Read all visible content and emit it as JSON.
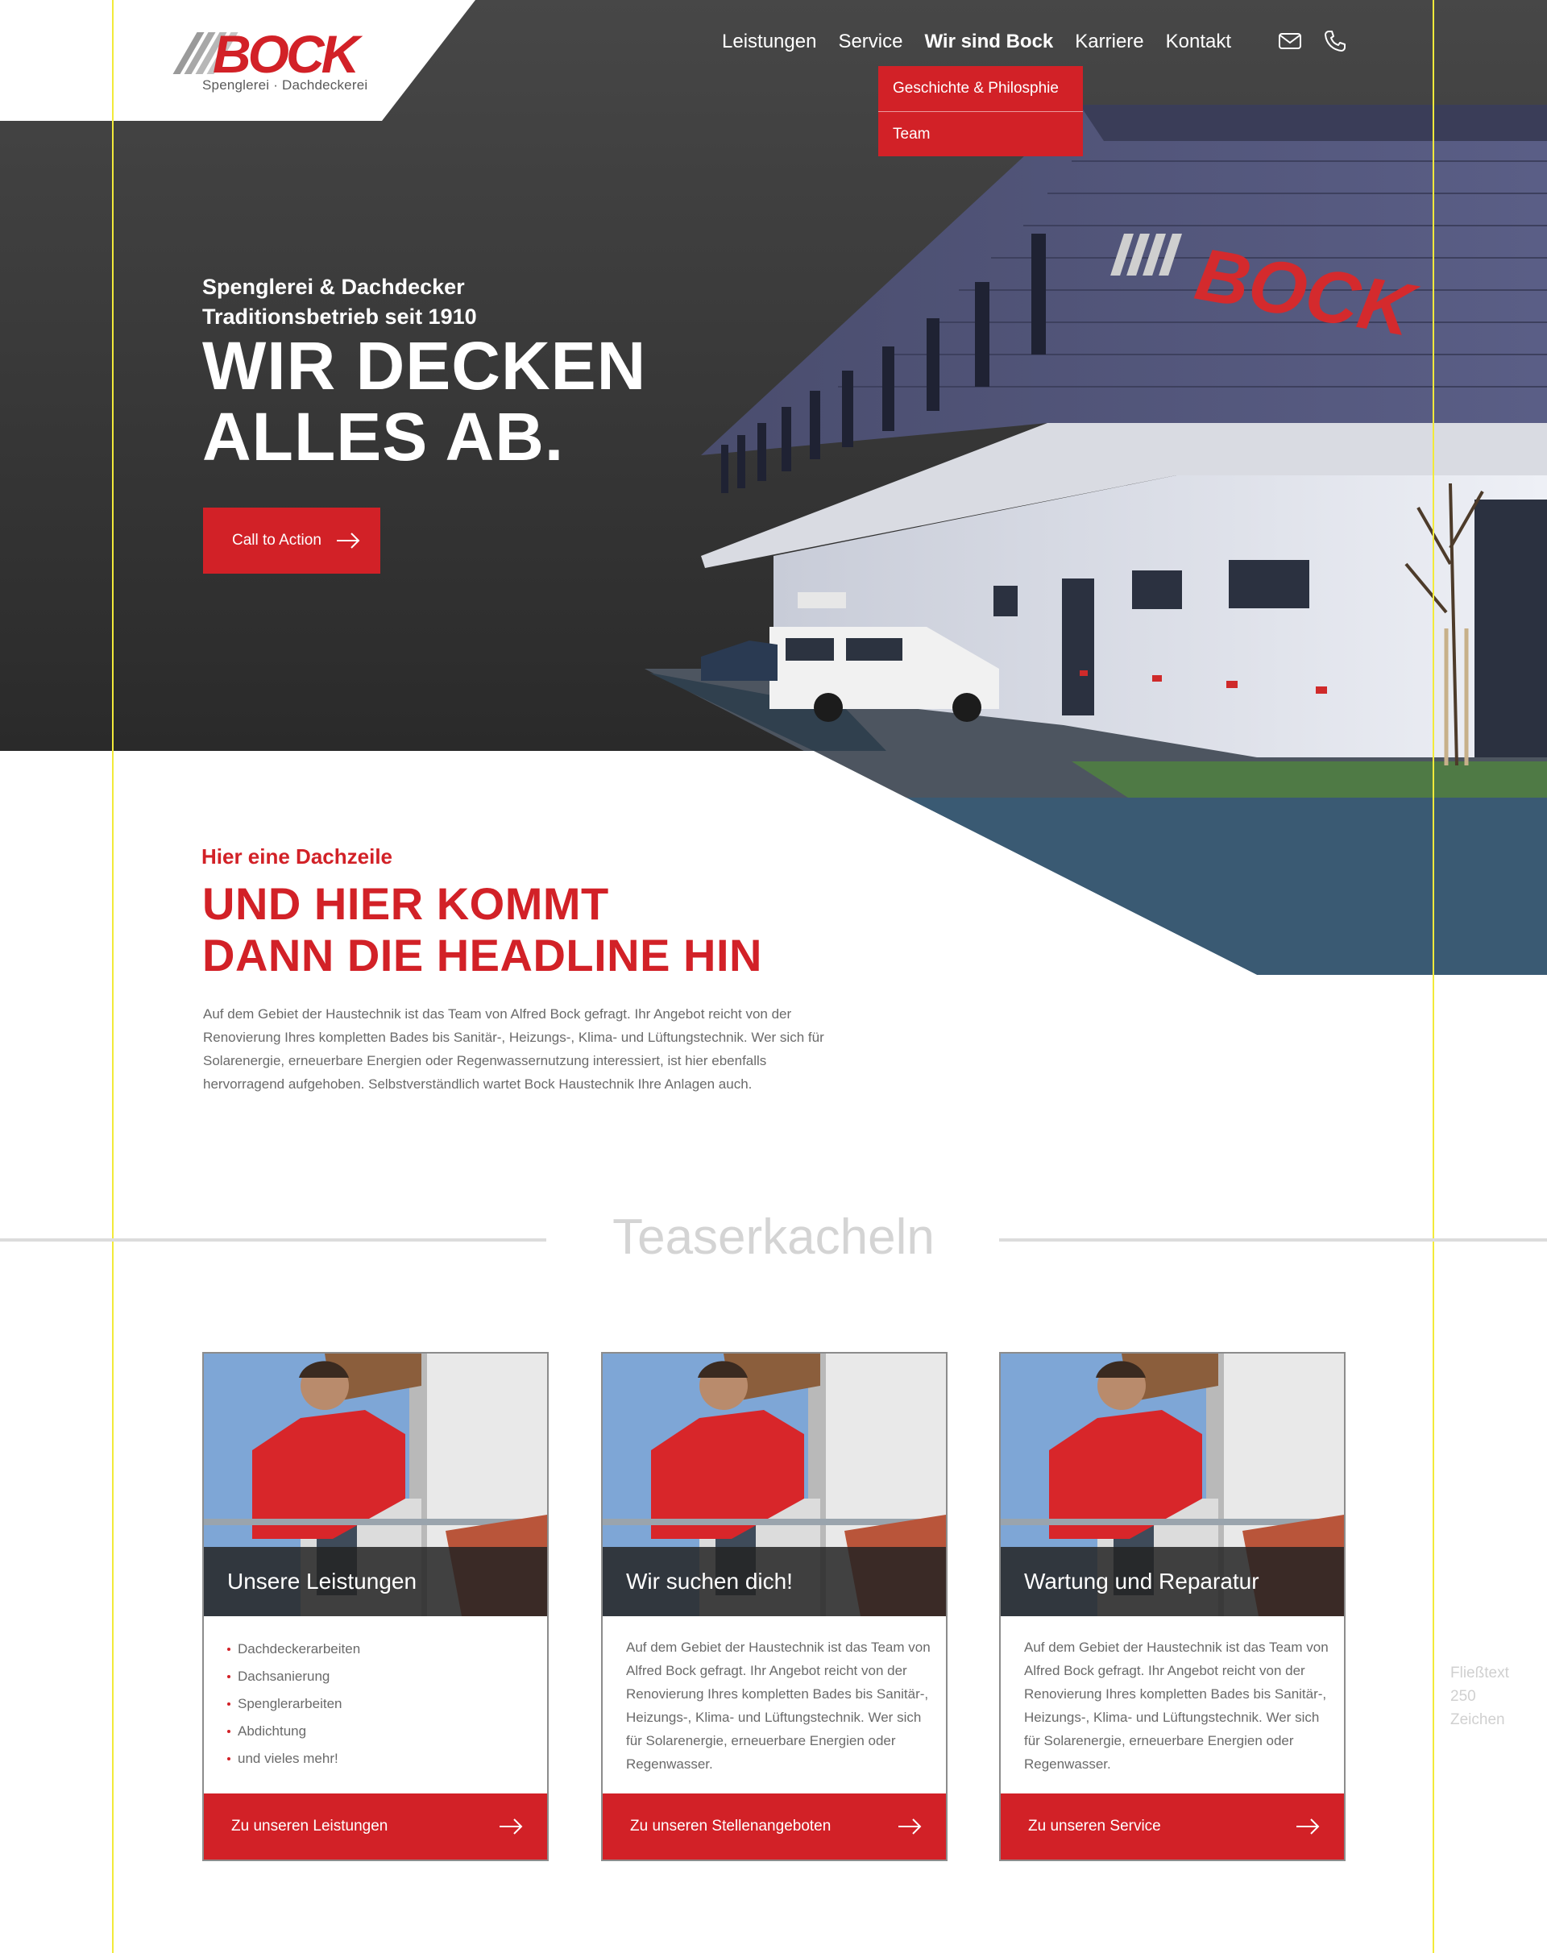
{
  "colors": {
    "brand_red": "#d22127",
    "hero_dark": "#3a3a3a",
    "footer_blue": "#3a5a73",
    "guide_yellow": "#f2ea3a"
  },
  "logo": {
    "wordmark": "BOCK",
    "subtitle": "Spenglerei · Dachdeckerei"
  },
  "nav": {
    "items": [
      {
        "label": "Leistungen",
        "active": false
      },
      {
        "label": "Service",
        "active": false
      },
      {
        "label": "Wir sind Bock",
        "active": true
      },
      {
        "label": "Karriere",
        "active": false
      },
      {
        "label": "Kontakt",
        "active": false
      }
    ],
    "icons": [
      "mail-icon",
      "phone-icon"
    ],
    "dropdown": [
      "Geschichte & Philosphie",
      "Team"
    ]
  },
  "hero": {
    "kicker_line1": "Spenglerei & Dachdecker",
    "kicker_line2": "Traditionsbetrieb seit 1910",
    "title_line1": "WIR DECKEN",
    "title_line2": "ALLES AB.",
    "cta_label": "Call to Action"
  },
  "intro": {
    "dachzeile": "Hier eine Dachzeile",
    "headline_line1": "UND HIER KOMMT",
    "headline_line2": "DANN DIE HEADLINE HIN",
    "text": "Auf dem Gebiet der Haustechnik ist das Team von Alfred Bock gefragt. Ihr Angebot reicht von der Renovierung Ihres kompletten Bades bis Sanitär-, Heizungs-, Klima- und Lüftungstechnik. Wer sich für Solarenergie, erneuerbare Energien oder Regenwassernutzung interessiert, ist hier ebenfalls hervorragend aufgehoben. Selbstverständlich wartet Bock Haustechnik Ihre Anlagen auch."
  },
  "section_label": "Teaserkacheln",
  "cards": [
    {
      "title": "Unsere Leistungen",
      "list": [
        "Dachdeckerarbeiten",
        "Dachsanierung",
        "Spenglerarbeiten",
        "Abdichtung",
        "und vieles mehr!"
      ],
      "button": "Zu unseren Leistungen"
    },
    {
      "title": "Wir suchen dich!",
      "text": "Auf dem Gebiet der Haustechnik ist das Team von Alfred Bock gefragt. Ihr Angebot reicht von der Renovierung Ihres kompletten Bades bis Sanitär-, Heizungs-, Klima- und Lüftungstechnik. Wer sich für Solarenergie, erneuerbare Energien oder Regenwasser.",
      "button": "Zu unseren Stellenangeboten"
    },
    {
      "title": "Wartung und Reparatur",
      "text": "Auf dem Gebiet der Haustechnik ist das Team von Alfred Bock gefragt. Ihr Angebot reicht von der Renovierung Ihres kompletten Bades bis Sanitär-, Heizungs-, Klima- und Lüftungstechnik. Wer sich für Solarenergie, erneuerbare Energien oder Regenwasser.",
      "button": "Zu unseren Service"
    }
  ],
  "side_note": {
    "line1": "Fließtext",
    "line2": "250",
    "line3": "Zeichen"
  }
}
